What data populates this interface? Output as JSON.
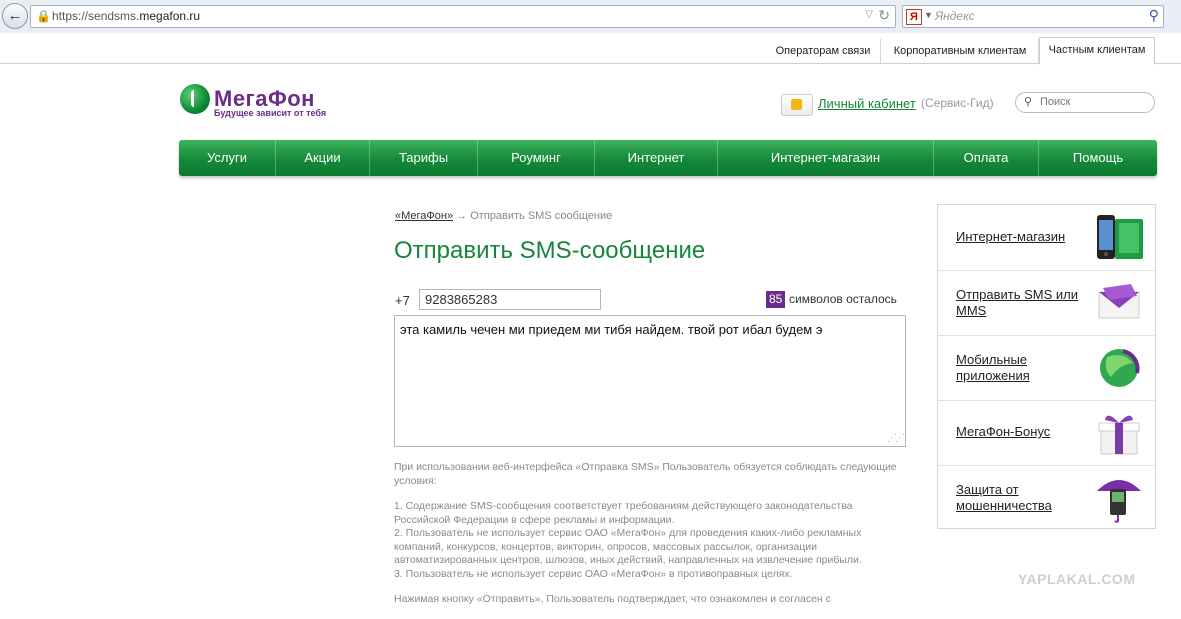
{
  "browser": {
    "back_icon": "back-arrow-icon",
    "url_prefix": "https://sendsms.",
    "url_host": "megafon.ru",
    "search_engine_icon": "Я",
    "search_placeholder": "Яндекс"
  },
  "top_tabs": [
    "Операторам связи",
    "Корпоративным клиентам",
    "Частным клиентам"
  ],
  "header": {
    "logo_name": "МегаФон",
    "logo_slogan": "Будущее зависит от тебя",
    "cabinet_link": "Личный кабинет",
    "cabinet_sub": "(Сервис-Гид)",
    "search_placeholder": "Поиск"
  },
  "nav": [
    "Услуги",
    "Акции",
    "Тарифы",
    "Роуминг",
    "Интернет",
    "Интернет-магазин",
    "Оплата",
    "Помощь"
  ],
  "breadcrumb": {
    "home": "«МегаФон»",
    "arrow": "→",
    "current": "Отправить SMS сообщение"
  },
  "page_title": "Отправить SMS-сообщение",
  "form": {
    "prefix": "+7",
    "phone": "9283865283",
    "chars_left": "85",
    "chars_label": "символов осталось",
    "message": "эта камиль чечен ми приедем ми тибя найдем. твой рот ибал будем э"
  },
  "terms": {
    "intro": "При использовании веб-интерфейса «Отправка SMS» Пользователь обязуется соблюдать следующие условия:",
    "items": [
      "1.  Содержание SMS-сообщения соответствует требованиям действующего законодательства Российской Федерации в сфере рекламы и информации.",
      "2.  Пользователь не использует сервис ОАО «МегаФон» для проведения каких-либо рекламных компаний, конкурсов, концертов, викторин, опросов, массовых рассылок, организации автоматизированных центров, шлюзов, иных действий, направленных на извлечение прибыли.",
      "3.  Пользователь не использует сервис ОАО «МегаФон» в противоправных целях."
    ],
    "footer": "Нажимая кнопку «Отправить», Пользователь подтверждает, что ознакомлен и согласен с"
  },
  "sidebar": [
    {
      "label": "Интернет-магазин",
      "icon": "phone-box-icon"
    },
    {
      "label": "Отправить SMS или MMS",
      "icon": "envelope-icon"
    },
    {
      "label": "Мобильные приложения",
      "icon": "globe-icon"
    },
    {
      "label": "МегаФон-Бонус",
      "icon": "gift-box-icon"
    },
    {
      "label": "Защита от мошенничества",
      "icon": "umbrella-phone-icon"
    }
  ],
  "watermark": "YAPLAKAL.COM",
  "colors": {
    "brand_green": "#16863a",
    "brand_purple": "#6a2d8b"
  }
}
